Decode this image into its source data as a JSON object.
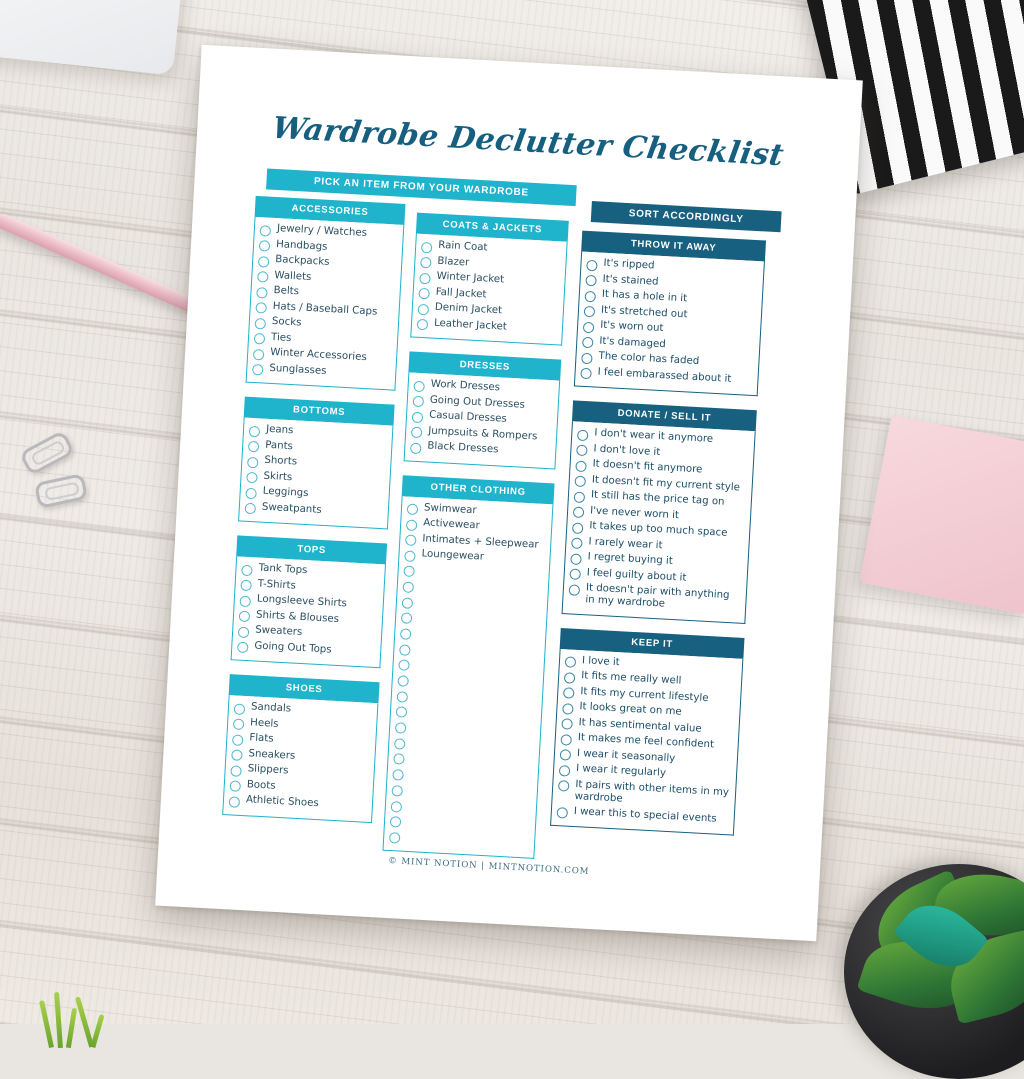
{
  "document": {
    "title": "Wardrobe Declutter Checklist",
    "footer": "© MINT NOTION | MINTNOTION.COM"
  },
  "colors": {
    "cyan": "#1fb3cc",
    "dark_teal": "#17607f",
    "text": "#2b4f63",
    "paper": "#ffffff"
  },
  "banners": {
    "left": "PICK AN ITEM FROM YOUR WARDROBE",
    "right": "SORT ACCORDINGLY"
  },
  "sections": {
    "accessories": {
      "header": "ACCESSORIES",
      "items": [
        "Jewelry / Watches",
        "Handbags",
        "Backpacks",
        "Wallets",
        "Belts",
        "Hats / Baseball Caps",
        "Socks",
        "Ties",
        "Winter Accessories",
        "Sunglasses"
      ]
    },
    "bottoms": {
      "header": "BOTTOMS",
      "items": [
        "Jeans",
        "Pants",
        "Shorts",
        "Skirts",
        "Leggings",
        "Sweatpants"
      ]
    },
    "tops": {
      "header": "TOPS",
      "items": [
        "Tank Tops",
        "T-Shirts",
        "Longsleeve Shirts",
        "Shirts & Blouses",
        "Sweaters",
        "Going Out Tops"
      ]
    },
    "shoes": {
      "header": "SHOES",
      "items": [
        "Sandals",
        "Heels",
        "Flats",
        "Sneakers",
        "Slippers",
        "Boots",
        "Athletic Shoes"
      ]
    },
    "coats_jackets": {
      "header": "COATS & JACKETS",
      "items": [
        "Rain Coat",
        "Blazer",
        "Winter Jacket",
        "Fall Jacket",
        "Denim Jacket",
        "Leather Jacket"
      ]
    },
    "dresses": {
      "header": "DRESSES",
      "items": [
        "Work Dresses",
        "Going Out Dresses",
        "Casual Dresses",
        "Jumpsuits & Rompers",
        "Black Dresses"
      ]
    },
    "other_clothing": {
      "header": "OTHER CLOTHING",
      "items": [
        "Swimwear",
        "Activewear",
        "Intimates + Sleepwear",
        "Loungewear",
        "",
        "",
        "",
        "",
        "",
        "",
        "",
        "",
        "",
        "",
        "",
        "",
        "",
        "",
        "",
        "",
        "",
        ""
      ]
    },
    "throw_it_away": {
      "header": "THROW IT AWAY",
      "items": [
        "It's ripped",
        "It's stained",
        "It has a hole in it",
        "It's stretched out",
        "It's worn out",
        "It's damaged",
        "The color has faded",
        "I feel embarassed about it"
      ]
    },
    "donate_sell": {
      "header": "DONATE / SELL IT",
      "items": [
        "I don't wear it anymore",
        "I don't love it",
        "It doesn't fit anymore",
        "It doesn't fit my current style",
        "It still has the price tag on",
        "I've never worn it",
        "It takes up too much space",
        "I rarely wear it",
        "I regret buying it",
        "I feel guilty about it",
        "It doesn't pair with anything in my wardrobe"
      ]
    },
    "keep_it": {
      "header": "KEEP IT",
      "items": [
        "I love it",
        "It fits me really well",
        "It fits my current lifestyle",
        "It looks great on me",
        "It has sentimental value",
        "It makes me feel confident",
        "I wear it seasonally",
        "I wear it regularly",
        "It pairs with other items in my wardrobe",
        "I wear this to special events"
      ]
    }
  }
}
